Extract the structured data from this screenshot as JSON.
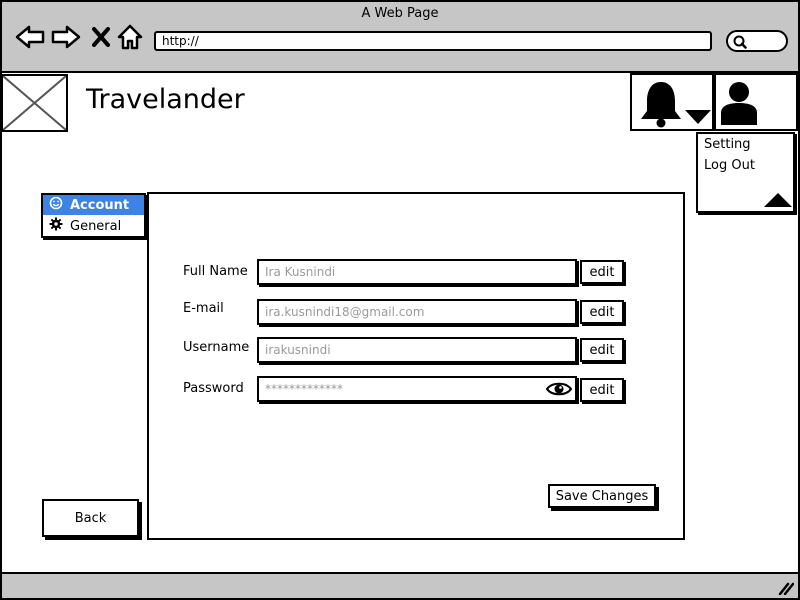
{
  "window": {
    "title": "A Web Page",
    "url": "http://"
  },
  "app": {
    "title": "Travelander"
  },
  "icons": {
    "back": "back-arrow-icon",
    "forward": "forward-arrow-icon",
    "close": "close-icon",
    "home": "home-icon",
    "search": "search-icon",
    "logo": "image-placeholder-icon",
    "bell": "bell-icon",
    "dropdown": "triangle-down-icon",
    "user": "user-icon",
    "collapse": "triangle-up-icon",
    "account": "smiley-icon",
    "general": "gear-icon",
    "eye": "eye-icon",
    "resize": "resize-grip-icon"
  },
  "user_menu": {
    "items": [
      "Setting",
      "Log Out"
    ]
  },
  "left_menu": {
    "items": [
      {
        "label": "Account",
        "active": true
      },
      {
        "label": "General",
        "active": false
      }
    ]
  },
  "form": {
    "fields": [
      {
        "label": "Full  Name",
        "value": "Ira Kusnindi"
      },
      {
        "label": "E-mail",
        "value": "ira.kusnindi18@gmail.com"
      },
      {
        "label": "Username",
        "value": "irakusnindi"
      },
      {
        "label": "Password",
        "value": "*************"
      }
    ],
    "edit_label": "edit",
    "save_label": "Save Changes"
  },
  "back_label": "Back",
  "colors": {
    "chrome": "#c6c6c6",
    "active_menu": "#3d82e6"
  }
}
